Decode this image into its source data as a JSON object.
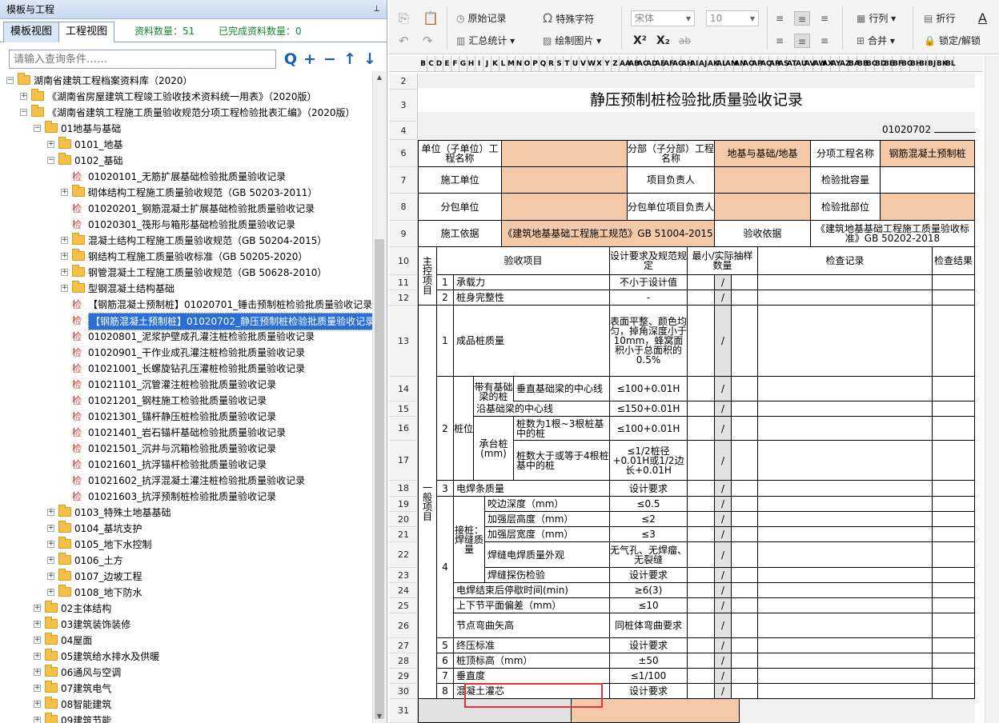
{
  "panel": {
    "title": "模板与工程",
    "pin": "⊥"
  },
  "tabs": {
    "template": "模板视图",
    "project": "工程视图"
  },
  "stats": {
    "count_label": "资料数量：51",
    "done_label": "已完成资料数量：0"
  },
  "search": {
    "placeholder": "请输入查询条件……"
  },
  "toolbar_buttons": {
    "search": "Q",
    "add": "+",
    "remove": "−",
    "up": "↑",
    "down": "↓"
  },
  "tree": [
    {
      "label": "湖南省建筑工程档案资料库（2020）",
      "type": "folder",
      "expander": "−"
    },
    {
      "label": "《湖南省房屋建筑工程竣工验收技术资料统一用表》（2020版）",
      "type": "folder",
      "expander": "+"
    },
    {
      "label": "《湖南省建筑工程施工质量验收规范分项工程检验批表汇编》（2020版）",
      "type": "folder",
      "expander": "−"
    },
    {
      "label": "01地基与基础",
      "type": "folder",
      "expander": "−"
    },
    {
      "label": "0101_地基",
      "type": "folder",
      "expander": "+"
    },
    {
      "label": "0102_基础",
      "type": "folder",
      "expander": "−"
    },
    {
      "label": "01020101_无筋扩展基础检验批质量验收记录",
      "type": "doc",
      "icon": "检"
    },
    {
      "label": "砌体结构工程施工质量验收规范（GB 50203-2011）",
      "type": "folder",
      "expander": "+"
    },
    {
      "label": "01020201_钢筋混凝土扩展基础检验批质量验收记录",
      "type": "doc",
      "icon": "检"
    },
    {
      "label": "01020301_筏形与箱形基础检验批质量验收记录",
      "type": "doc",
      "icon": "检"
    },
    {
      "label": "混凝土结构工程施工质量验收规范（GB 50204-2015）",
      "type": "folder",
      "expander": "+"
    },
    {
      "label": "钢结构工程施工质量验收标准（GB 50205-2020）",
      "type": "folder",
      "expander": "+"
    },
    {
      "label": "钢管混凝土工程施工质量验收规范（GB 50628-2010）",
      "type": "folder",
      "expander": "+"
    },
    {
      "label": "型钢混凝土结构基础",
      "type": "folder",
      "expander": "+"
    },
    {
      "label": "【钢筋混凝土预制桩】01020701_锤击预制桩检验批质量验收记录",
      "type": "doc",
      "icon": "检"
    },
    {
      "label": "【钢筋混凝土预制桩】01020702_静压预制桩检验批质量验收记录",
      "type": "doc",
      "icon": "检",
      "selected": true
    },
    {
      "label": "01020801_泥浆护壁成孔灌注桩检验批质量验收记录",
      "type": "doc",
      "icon": "检"
    },
    {
      "label": "01020901_干作业成孔灌注桩检验批质量验收记录",
      "type": "doc",
      "icon": "检"
    },
    {
      "label": "01021001_长螺旋钻孔压灌桩检验批质量验收记录",
      "type": "doc",
      "icon": "检"
    },
    {
      "label": "01021101_沉管灌注桩检验批质量验收记录",
      "type": "doc",
      "icon": "检"
    },
    {
      "label": "01021201_钢柱施工检验批质量验收记录",
      "type": "doc",
      "icon": "检"
    },
    {
      "label": "01021301_锚杆静压桩检验批质量验收记录",
      "type": "doc",
      "icon": "检"
    },
    {
      "label": "01021401_岩石锚杆基础检验批质量验收记录",
      "type": "doc",
      "icon": "检"
    },
    {
      "label": "01021501_沉井与沉箱检验批质量验收记录",
      "type": "doc",
      "icon": "检"
    },
    {
      "label": "01021601_抗浮锚杆检验批质量验收记录",
      "type": "doc",
      "icon": "检"
    },
    {
      "label": "01021602_抗浮混凝土灌注桩检验批质量验收记录",
      "type": "doc",
      "icon": "检"
    },
    {
      "label": "01021603_抗浮预制桩检验批质量验收记录",
      "type": "doc",
      "icon": "检"
    },
    {
      "label": "0103_特殊土地基基础",
      "type": "folder",
      "expander": "+"
    },
    {
      "label": "0104_基坑支护",
      "type": "folder",
      "expander": "+"
    },
    {
      "label": "0105_地下水控制",
      "type": "folder",
      "expander": "+"
    },
    {
      "label": "0106_土方",
      "type": "folder",
      "expander": "+"
    },
    {
      "label": "0107_边坡工程",
      "type": "folder",
      "expander": "+"
    },
    {
      "label": "0108_地下防水",
      "type": "folder",
      "expander": "+"
    },
    {
      "label": "02主体结构",
      "type": "folder",
      "expander": "+"
    },
    {
      "label": "03建筑装饰装修",
      "type": "folder",
      "expander": "+"
    },
    {
      "label": "04屋面",
      "type": "folder",
      "expander": "+"
    },
    {
      "label": "05建筑给水排水及供暖",
      "type": "folder",
      "expander": "+"
    },
    {
      "label": "06通风与空调",
      "type": "folder",
      "expander": "+"
    },
    {
      "label": "07建筑电气",
      "type": "folder",
      "expander": "+"
    },
    {
      "label": "08智能建筑",
      "type": "folder",
      "expander": "+"
    },
    {
      "label": "09建筑节能",
      "type": "folder",
      "expander": "+"
    }
  ],
  "toolbar": {
    "raw_record": "原始记录",
    "special_char": "特殊字符",
    "summary": "汇总统计",
    "draw_image": "绘制图片",
    "font": "宋体",
    "size": "10",
    "row_col": "行列",
    "merge": "合并",
    "wrap": "折行",
    "lock": "锁定/解锁",
    "sup": "X²",
    "sub": "X₂",
    "strike": "ab"
  },
  "columns": [
    "B",
    "C",
    "D",
    "E",
    "F",
    "G",
    "H",
    "I",
    "J",
    "K",
    "L",
    "M",
    "N",
    "O",
    "P",
    "Q",
    "R",
    "S",
    "T",
    "U",
    "V",
    "W",
    "X",
    "Y",
    "Z",
    "AA",
    "AB",
    "AC",
    "AD",
    "AE",
    "AF",
    "AG",
    "AH",
    "AI",
    "AJ",
    "AK",
    "AL",
    "AM",
    "AN",
    "AO",
    "AP",
    "AQ",
    "AR",
    "AS",
    "AT",
    "AU",
    "AV",
    "AW",
    "AX",
    "AY",
    "AZ",
    "BA",
    "BB",
    "BC",
    "BD",
    "BE",
    "BF",
    "BG",
    "BH",
    "BI",
    "BJ",
    "BK",
    "BL"
  ],
  "row_numbers": [
    "2",
    "3",
    "4",
    "6",
    "7",
    "8",
    "9",
    "10",
    "11",
    "12",
    "13",
    "14",
    "15",
    "16",
    "17",
    "18",
    "19",
    "20",
    "21",
    "22",
    "23",
    "24",
    "25",
    "26",
    "27",
    "28",
    "29",
    "30",
    "31"
  ],
  "form": {
    "title": "静压预制桩检验批质量验收记录",
    "number": "01020702",
    "unit_label": "单位（子单位）工程名称",
    "sub_label": "分部（子分部）工程名称",
    "sub_value": "地基与基础/地基",
    "item_label": "分项工程名称",
    "item_value": "钢筋混凝土预制桩",
    "constructor": "施工单位",
    "pm": "项目负责人",
    "capacity": "检验批容量",
    "subcontractor": "分包单位",
    "sub_pm": "分包单位项目负责人",
    "location": "检验批部位",
    "basis": "施工依据",
    "basis_value": "《建筑地基基础工程施工规范》GB 51004-2015",
    "accept_basis": "验收依据",
    "accept_value": "《建筑地基基础工程施工质量验收标准》GB 50202-2018",
    "h_main": "主控项目",
    "h_items": "验收项目",
    "h_design": "设计要求及规范规定",
    "h_sample": "最小/实际抽样数量",
    "h_record": "检查记录",
    "h_result": "检查结果",
    "h_general": "一般项目",
    "slash": "/",
    "rows": {
      "r11": {
        "n": "1",
        "item": "承载力",
        "req": "不小于设计值"
      },
      "r12": {
        "n": "2",
        "item": "桩身完整性",
        "req": "-"
      },
      "r13": {
        "n": "1",
        "item": "成品桩质量",
        "req": "表面平整、颜色均匀，掉角深度小于10mm，蜂窝面积小于总面积的0.5%"
      },
      "pile_pos": "桩位",
      "with_beam": "带有基础梁的桩(mm)",
      "r14": {
        "item": "垂直基础梁的中心线",
        "req": "≤100+0.01H"
      },
      "r15": {
        "item": "沿基础梁的中心线",
        "req": "≤150+0.01H"
      },
      "platform": "承台桩(mm)",
      "r16": {
        "item": "桩数为1根~3根桩基中的桩",
        "req": "≤100+0.01H"
      },
      "r17": {
        "item": "桩数大于或等于4根桩基中的桩",
        "req": "≤1/2桩径+0.01H或1/2边长+0.01H"
      },
      "r18": {
        "n": "3",
        "item": "电焊条质量",
        "req": "设计要求"
      },
      "welding": "接桩：焊缝质量",
      "r19": {
        "item": "咬边深度（mm）",
        "req": "≤0.5"
      },
      "r20": {
        "item": "加强层高度（mm）",
        "req": "≤2"
      },
      "r21": {
        "item": "加强层宽度（mm）",
        "req": "≤3"
      },
      "r22": {
        "item": "焊缝电焊质量外观",
        "req": "无气孔、无焊瘤、无裂缝"
      },
      "r23": {
        "item": "焊缝探伤检验",
        "req": "设计要求"
      },
      "r24": {
        "item": "电焊结束后停歇时间(min)",
        "req": "≥6(3)"
      },
      "r25": {
        "item": "上下节平面偏差（mm）",
        "req": "≤10"
      },
      "r26": {
        "item": "节点弯曲矢高",
        "req": "同桩体弯曲要求"
      },
      "r27": {
        "n": "5",
        "item": "终压标准",
        "req": "设计要求"
      },
      "r28": {
        "n": "6",
        "item": "桩顶标高（mm）",
        "req": "±50"
      },
      "r29": {
        "n": "7",
        "item": "垂直度",
        "req": "≤1/100"
      },
      "r30": {
        "n": "8",
        "item": "混凝土灌芯",
        "req": "设计要求"
      },
      "n2": "2",
      "n4": "4"
    }
  },
  "colors": {
    "tan": "#f3c9a7",
    "selection": "#2b6fd6",
    "stats": "#138a2e",
    "highlight": "#e03535"
  }
}
